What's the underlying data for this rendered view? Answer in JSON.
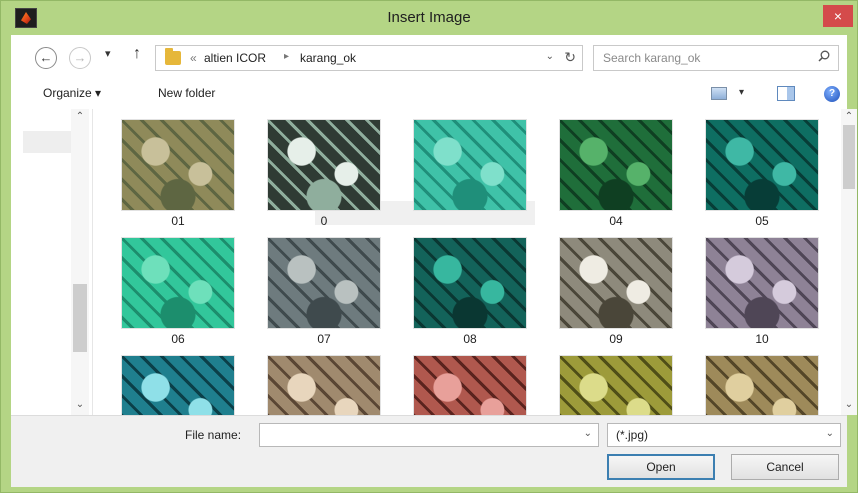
{
  "window": {
    "title": "Insert Image",
    "close_glyph": "×"
  },
  "address": {
    "back_glyph": "←",
    "forward_glyph": "→",
    "recent_glyph": "▾",
    "up_glyph": "↑",
    "crumb_prefix": "«",
    "crumbs": [
      "altien ICOR",
      "karang_ok"
    ],
    "separator": "▸",
    "dropdown_glyph": "⌄",
    "refresh_glyph": "↻",
    "search_placeholder": "Search karang_ok"
  },
  "commandbar": {
    "organize_label": "Organize ▾",
    "new_folder_label": "New folder",
    "view_drop_glyph": "▾",
    "help_glyph": "?"
  },
  "files": {
    "items": [
      {
        "caption": "01",
        "colors": [
          "#8f8a5a",
          "#c8c09a",
          "#5e6642"
        ]
      },
      {
        "caption": "0",
        "colors": [
          "#2f3b34",
          "#e6efe9",
          "#8fae9d"
        ]
      },
      {
        "caption": "",
        "colors": [
          "#3fc2a8",
          "#7fe0cb",
          "#1f8f7a"
        ]
      },
      {
        "caption": "04",
        "colors": [
          "#1f6e3a",
          "#56b26a",
          "#0f3f22"
        ]
      },
      {
        "caption": "05",
        "colors": [
          "#0e6e62",
          "#3fb8a5",
          "#073d37"
        ]
      },
      {
        "caption": "06",
        "colors": [
          "#32c79b",
          "#6ee0bb",
          "#1c8e6d"
        ]
      },
      {
        "caption": "07",
        "colors": [
          "#6e7b7e",
          "#b9c1c0",
          "#3f4a4d"
        ]
      },
      {
        "caption": "08",
        "colors": [
          "#13635a",
          "#37b79f",
          "#0a3732"
        ]
      },
      {
        "caption": "09",
        "colors": [
          "#8e8a7c",
          "#efece3",
          "#4a4639"
        ]
      },
      {
        "caption": "10",
        "colors": [
          "#8e8296",
          "#d5cbdc",
          "#4f4656"
        ]
      },
      {
        "caption": "",
        "colors": [
          "#1f7f8e",
          "#8fe0e8",
          "#0b3f48"
        ]
      },
      {
        "caption": "",
        "colors": [
          "#a08a6e",
          "#e8d6bd",
          "#5a4634"
        ]
      },
      {
        "caption": "",
        "colors": [
          "#b0584e",
          "#e8a09a",
          "#5a231e"
        ]
      },
      {
        "caption": "",
        "colors": [
          "#9d9b3a",
          "#dcdc8a",
          "#4f4e17"
        ]
      },
      {
        "caption": "",
        "colors": [
          "#9e8a5a",
          "#e0cf9f",
          "#544628"
        ]
      }
    ]
  },
  "footer": {
    "file_name_label": "File name:",
    "file_name_value": "",
    "file_name_drop_glyph": "⌄",
    "file_type": "(*.jpg)",
    "file_type_drop_glyph": "⌄",
    "open_label": "Open",
    "cancel_label": "Cancel"
  },
  "scroll": {
    "up_glyph": "⌃",
    "down_glyph": "⌄"
  },
  "colors": {
    "title_bar": "#b4d585",
    "close_button": "#d44b4b",
    "default_button_border": "#3c7fb1"
  }
}
